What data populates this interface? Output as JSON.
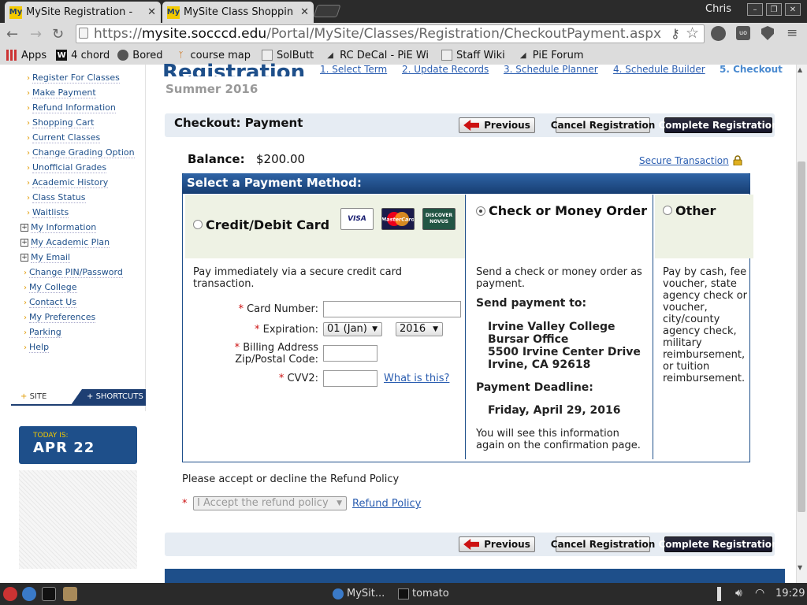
{
  "browser": {
    "tabs": [
      {
        "title": "MySite Registration -",
        "favicon": "My"
      },
      {
        "title": "MySite Class Shoppin",
        "favicon": "My"
      }
    ],
    "user": "Chris",
    "url_prefix": "https://",
    "url_domain": "mysite.socccd.edu",
    "url_path": "/Portal/MySite/Classes/Registration/CheckoutPayment.aspx",
    "bookmarks": [
      "Apps",
      "4 chord",
      "Bored",
      "course map",
      "SolButt",
      "RC DeCal - PiE Wi",
      "Staff Wiki",
      "PiE Forum"
    ]
  },
  "sidebar": {
    "items": [
      {
        "label": "Register For Classes",
        "type": "dot"
      },
      {
        "label": "Make Payment",
        "type": "dot"
      },
      {
        "label": "Refund Information",
        "type": "dot"
      },
      {
        "label": "Shopping Cart",
        "type": "dot"
      },
      {
        "label": "Current Classes",
        "type": "dot"
      },
      {
        "label": "Change Grading Option",
        "type": "dot"
      },
      {
        "label": "Unofficial Grades",
        "type": "dot"
      },
      {
        "label": "Academic History",
        "type": "dot"
      },
      {
        "label": "Class Status",
        "type": "dot"
      },
      {
        "label": "Waitlists",
        "type": "dot"
      },
      {
        "label": "My Information",
        "type": "plus"
      },
      {
        "label": "My Academic Plan",
        "type": "plus"
      },
      {
        "label": "My Email",
        "type": "plus"
      },
      {
        "label": "Change PIN/Password",
        "type": "dot"
      },
      {
        "label": "My College",
        "type": "dot"
      },
      {
        "label": "Contact Us",
        "type": "dot"
      },
      {
        "label": "My Preferences",
        "type": "dot"
      },
      {
        "label": "Parking",
        "type": "dot"
      },
      {
        "label": "Help",
        "type": "dot"
      }
    ],
    "site_tab": "SITE",
    "shortcuts_tab": "SHORTCUTS",
    "today_label": "TODAY IS:",
    "today_value": "APR 22"
  },
  "header": {
    "title": "Registration",
    "term": "Summer 2016",
    "steps": [
      "1. Select Term",
      "2. Update Records",
      "3. Schedule Planner",
      "4. Schedule Builder",
      "5. Checkout"
    ]
  },
  "checkout": {
    "title": "Checkout: Payment",
    "previous_label": "Previous",
    "cancel_label": "Cancel Registration",
    "complete_label": "Complete Registration",
    "balance_label": "Balance:",
    "balance_value": "$200.00",
    "secure_label": "Secure Transaction"
  },
  "payment": {
    "header": "Select a Payment Method:",
    "card": {
      "label": "Credit/Debit Card",
      "brands": [
        "VISA",
        "MasterCard",
        "DISCOVER NOVUS"
      ],
      "description": "Pay immediately via a secure credit card transaction.",
      "card_number_label": "Card Number:",
      "expiration_label": "Expiration:",
      "exp_month": "01 (Jan)",
      "exp_year": "2016",
      "zip_label_1": "Billing Address",
      "zip_label_2": "Zip/Postal Code:",
      "cvv_label": "CVV2:",
      "cvv_help": "What is this?"
    },
    "check": {
      "label": "Check or Money Order",
      "description": "Send a check or money order as payment.",
      "send_to_label": "Send payment to:",
      "address": [
        "Irvine Valley College",
        "Bursar Office",
        "5500 Irvine Center Drive",
        "Irvine, CA 92618"
      ],
      "deadline_label": "Payment Deadline:",
      "deadline_value": "Friday, April 29, 2016",
      "note": "You will see this information again on the confirmation page."
    },
    "other": {
      "label": "Other",
      "description": "Pay by cash, fee voucher, state agency check or voucher, city/county agency check, military reimbursement, or tuition reimbursement."
    }
  },
  "refund": {
    "prompt": "Please accept or decline the Refund Policy",
    "select_value": "I Accept the refund policy",
    "policy_link": "Refund Policy"
  },
  "taskbar": {
    "items": [
      "MySit...",
      "tomato"
    ],
    "clock": "19:29"
  }
}
